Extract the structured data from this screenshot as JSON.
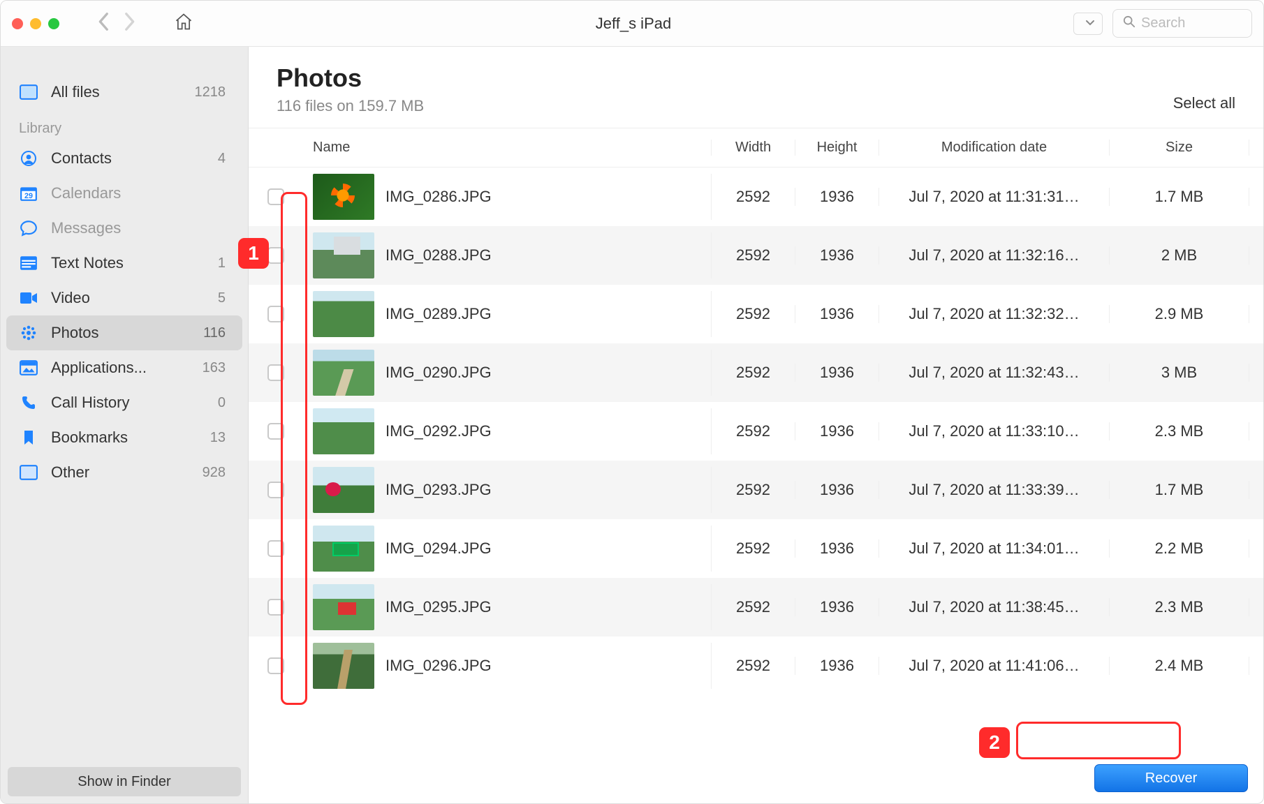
{
  "window": {
    "title": "Jeff_s iPad"
  },
  "search": {
    "placeholder": "Search"
  },
  "sidebar": {
    "allfiles": {
      "label": "All files",
      "count": "1218"
    },
    "libraryHeader": "Library",
    "items": [
      {
        "label": "Contacts",
        "count": "4",
        "icon": "contacts"
      },
      {
        "label": "Calendars",
        "count": "",
        "icon": "calendar",
        "dim": true
      },
      {
        "label": "Messages",
        "count": "",
        "icon": "messages",
        "dim": true
      },
      {
        "label": "Text Notes",
        "count": "1",
        "icon": "notes"
      },
      {
        "label": "Video",
        "count": "5",
        "icon": "video"
      },
      {
        "label": "Photos",
        "count": "116",
        "icon": "photos",
        "selected": true
      },
      {
        "label": "Applications...",
        "count": "163",
        "icon": "apps"
      },
      {
        "label": "Call History",
        "count": "0",
        "icon": "call"
      },
      {
        "label": "Bookmarks",
        "count": "13",
        "icon": "bookmarks"
      },
      {
        "label": "Other",
        "count": "928",
        "icon": "other"
      }
    ],
    "footer": "Show in Finder"
  },
  "main": {
    "title": "Photos",
    "subtitle": "116 files on 159.7 MB",
    "selectAll": "Select all",
    "columns": {
      "name": "Name",
      "width": "Width",
      "height": "Height",
      "date": "Modification date",
      "size": "Size"
    },
    "rows": [
      {
        "name": "IMG_0286.JPG",
        "width": "2592",
        "height": "1936",
        "date": "Jul 7, 2020 at 11:31:31…",
        "size": "1.7 MB"
      },
      {
        "name": "IMG_0288.JPG",
        "width": "2592",
        "height": "1936",
        "date": "Jul 7, 2020 at 11:32:16…",
        "size": "2 MB"
      },
      {
        "name": "IMG_0289.JPG",
        "width": "2592",
        "height": "1936",
        "date": "Jul 7, 2020 at 11:32:32…",
        "size": "2.9 MB"
      },
      {
        "name": "IMG_0290.JPG",
        "width": "2592",
        "height": "1936",
        "date": "Jul 7, 2020 at 11:32:43…",
        "size": "3 MB"
      },
      {
        "name": "IMG_0292.JPG",
        "width": "2592",
        "height": "1936",
        "date": "Jul 7, 2020 at 11:33:10…",
        "size": "2.3 MB"
      },
      {
        "name": "IMG_0293.JPG",
        "width": "2592",
        "height": "1936",
        "date": "Jul 7, 2020 at 11:33:39…",
        "size": "1.7 MB"
      },
      {
        "name": "IMG_0294.JPG",
        "width": "2592",
        "height": "1936",
        "date": "Jul 7, 2020 at 11:34:01…",
        "size": "2.2 MB"
      },
      {
        "name": "IMG_0295.JPG",
        "width": "2592",
        "height": "1936",
        "date": "Jul 7, 2020 at 11:38:45…",
        "size": "2.3 MB"
      },
      {
        "name": "IMG_0296.JPG",
        "width": "2592",
        "height": "1936",
        "date": "Jul 7, 2020 at 11:41:06…",
        "size": "2.4 MB"
      }
    ],
    "recover": "Recover"
  },
  "annotations": {
    "one": "1",
    "two": "2"
  }
}
